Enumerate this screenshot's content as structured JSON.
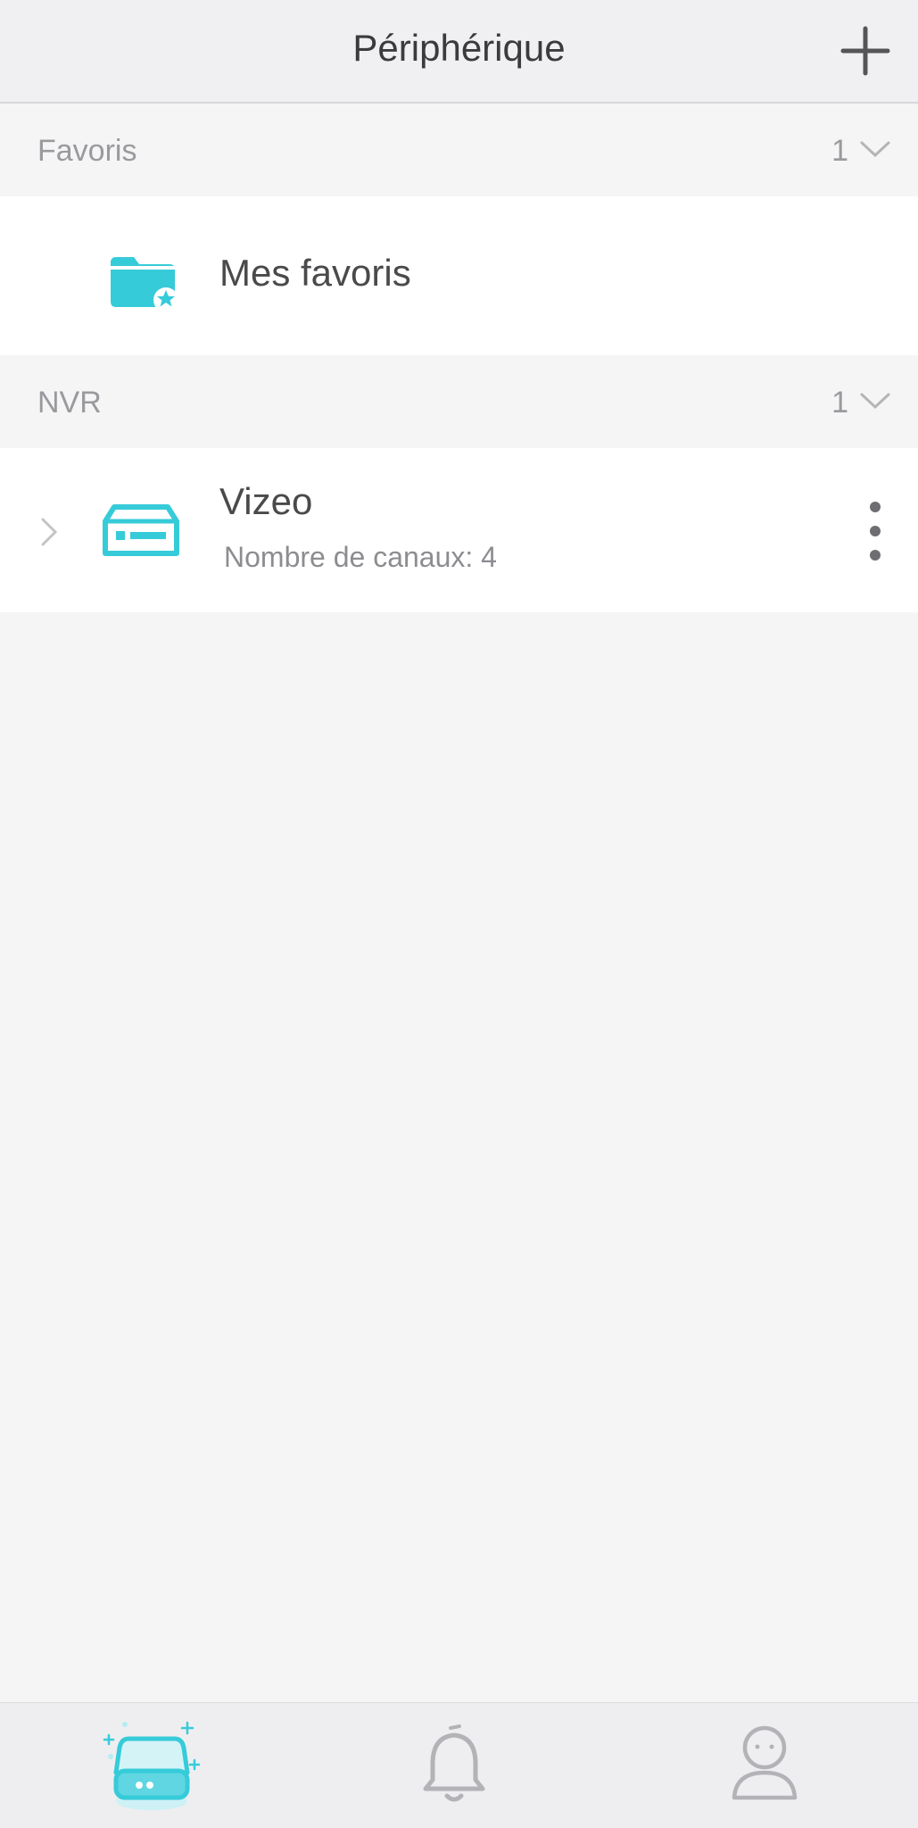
{
  "header": {
    "title": "Périphérique"
  },
  "sections": {
    "favorites": {
      "label": "Favoris",
      "count": "1"
    },
    "nvr": {
      "label": "NVR",
      "count": "1"
    }
  },
  "favorites_row": {
    "label": "Mes favoris"
  },
  "device": {
    "name": "Vizeo",
    "subtitle": "Nombre de canaux: 4"
  },
  "icons": {
    "add": "plus-icon",
    "chevron": "chevron-down-icon",
    "folder": "favorite-folder-icon",
    "nvr": "nvr-device-icon",
    "more": "more-vertical-icon",
    "tab_devices": "device-tab-icon",
    "tab_alarms": "bell-icon",
    "tab_profile": "user-icon"
  },
  "colors": {
    "accent": "#36cbd9",
    "text": "#4a4a4c",
    "muted": "#9a9a9e"
  }
}
